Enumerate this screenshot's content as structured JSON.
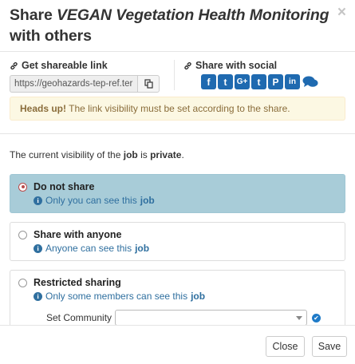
{
  "dialog": {
    "title_prefix": "Share ",
    "title_item": "VEGAN Vegetation Health Monitoring",
    "title_suffix": " with others",
    "close_glyph": "×"
  },
  "link": {
    "label": "Get shareable link",
    "url": "https://geohazards-tep-ref.ter",
    "icon": "link-icon",
    "copy_icon": "clipboard-icon"
  },
  "social": {
    "label": "Share with social",
    "icon": "link-icon",
    "networks": [
      {
        "name": "facebook",
        "glyph": "f"
      },
      {
        "name": "twitter",
        "glyph": "t"
      },
      {
        "name": "google-plus",
        "glyph": "G+"
      },
      {
        "name": "tumblr",
        "glyph": "t"
      },
      {
        "name": "pinterest",
        "glyph": "P"
      },
      {
        "name": "linkedin",
        "glyph": "in"
      },
      {
        "name": "comments",
        "glyph": "💬"
      }
    ]
  },
  "alert": {
    "strong": "Heads up!",
    "text": " The link visibility must be set according to the share."
  },
  "visibility": {
    "prefix": "The current visibility of the ",
    "entity": "job",
    "middle": " is ",
    "state": "private",
    "suffix": "."
  },
  "options": [
    {
      "label": "Do not share",
      "desc_prefix": "Only you can see this ",
      "desc_entity": "job",
      "selected": true
    },
    {
      "label": "Share with anyone",
      "desc_prefix": "Anyone can see this ",
      "desc_entity": "job",
      "selected": false
    },
    {
      "label": "Restricted sharing",
      "desc_prefix": "Only some members can see this ",
      "desc_entity": "job",
      "selected": false
    }
  ],
  "community": {
    "label": "Set Community",
    "value": ""
  },
  "footer": {
    "close_label": "Close",
    "save_label": "Save"
  },
  "colors": {
    "selected_bg": "#a8ccd8",
    "link_blue": "#2f6f9f",
    "social_blue": "#1f6ab0",
    "alert_bg": "#fcf8e3",
    "alert_text": "#8a6d3b"
  }
}
